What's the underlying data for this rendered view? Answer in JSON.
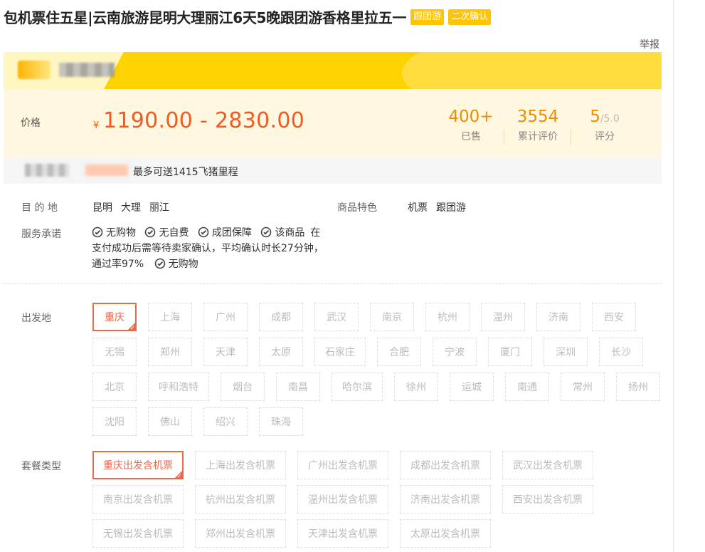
{
  "title": "包机票住五星|云南旅游昆明大理丽江6天5晚跟团游香格里拉五一",
  "tags": [
    "跟团游",
    "二次确认"
  ],
  "report_label": "举报",
  "price": {
    "label": "价格",
    "currency": "¥",
    "range": "1190.00 - 2830.00"
  },
  "stats": {
    "sold": {
      "value": "400+",
      "label": "已售"
    },
    "reviews": {
      "value": "3554",
      "label": "累计评价"
    },
    "rating": {
      "value": "5",
      "max": "/5.0",
      "label": "评分"
    }
  },
  "mileage_text": "最多可送1415飞猪里程",
  "destination": {
    "label": "目 的 地",
    "values": [
      "昆明",
      "大理",
      "丽江"
    ]
  },
  "features": {
    "label": "商品特色",
    "values": [
      "机票",
      "跟团游"
    ]
  },
  "service": {
    "label": "服务承诺",
    "items": [
      "无购物",
      "无自费",
      "成团保障"
    ],
    "note_head": "该商品",
    "note": "在支付成功后需等待卖家确认，平均确认时长27分钟，通过率97%",
    "last_item": "无购物"
  },
  "departure": {
    "label": "出发地",
    "selected": "重庆",
    "options": [
      "重庆",
      "上海",
      "广州",
      "成都",
      "武汉",
      "南京",
      "杭州",
      "温州",
      "济南",
      "西安",
      "无锡",
      "郑州",
      "天津",
      "太原",
      "石家庄",
      "合肥",
      "宁波",
      "厦门",
      "深圳",
      "长沙",
      "北京",
      "呼和浩特",
      "烟台",
      "南昌",
      "哈尔滨",
      "徐州",
      "运城",
      "南通",
      "常州",
      "扬州",
      "沈阳",
      "佛山",
      "绍兴",
      "珠海"
    ]
  },
  "package": {
    "label": "套餐类型",
    "selected": "重庆出发含机票",
    "options": [
      "重庆出发含机票",
      "上海出发含机票",
      "广州出发含机票",
      "成都出发含机票",
      "武汉出发含机票",
      "南京出发含机票",
      "杭州出发含机票",
      "温州出发含机票",
      "济南出发含机票",
      "西安出发含机票",
      "无锡出发含机票",
      "郑州出发含机票",
      "天津出发含机票",
      "太原出发含机票"
    ]
  },
  "colors": {
    "accent": "#f15a22",
    "tag": "#ffc500",
    "banner": "#ffd200",
    "selected_border": "#e66a4c"
  }
}
